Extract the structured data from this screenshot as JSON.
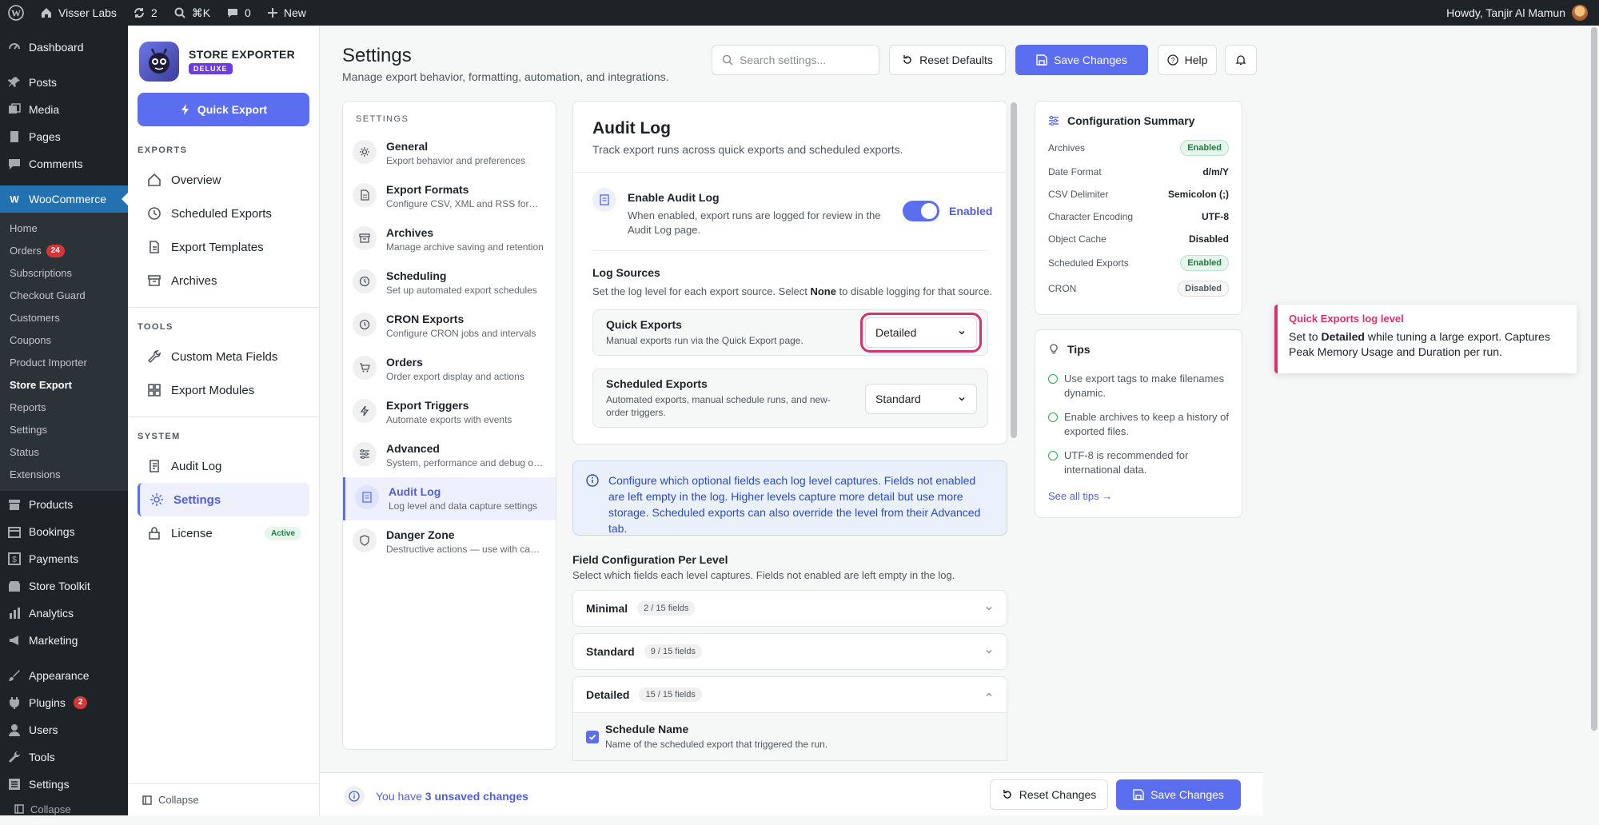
{
  "adminbar": {
    "site": "Visser Labs",
    "updates": "2",
    "shortcut": "⌘K",
    "comments": "0",
    "new": "New",
    "howdy": "Howdy, Tanjir Al Mamun"
  },
  "wpmenu": {
    "top": [
      "Dashboard",
      "Posts",
      "Media",
      "Pages",
      "Comments"
    ],
    "woo": "WooCommerce",
    "sub": [
      {
        "label": "Home"
      },
      {
        "label": "Orders",
        "badge": "24"
      },
      {
        "label": "Subscriptions"
      },
      {
        "label": "Checkout Guard"
      },
      {
        "label": "Customers"
      },
      {
        "label": "Coupons"
      },
      {
        "label": "Product Importer"
      },
      {
        "label": "Store Export"
      },
      {
        "label": "Reports"
      },
      {
        "label": "Settings"
      },
      {
        "label": "Status"
      },
      {
        "label": "Extensions"
      }
    ],
    "bottom": [
      "Products",
      "Bookings",
      "Payments",
      "Store Toolkit",
      "Analytics",
      "Marketing",
      "Appearance",
      "Plugins",
      "Users",
      "Tools",
      "Settings"
    ],
    "plugins_badge": "2",
    "collapse": "Collapse"
  },
  "plugin": {
    "name": "STORE EXPORTER",
    "tier": "DELUXE",
    "quick_export": "Quick Export",
    "sections": {
      "exports": "EXPORTS",
      "tools": "TOOLS",
      "system": "SYSTEM"
    },
    "exports": [
      "Overview",
      "Scheduled Exports",
      "Export Templates",
      "Archives"
    ],
    "tools": [
      "Custom Meta Fields",
      "Export Modules"
    ],
    "system": [
      "Audit Log",
      "Settings",
      "License"
    ],
    "license_status": "Active",
    "collapse": "Collapse"
  },
  "header": {
    "title": "Settings",
    "subtitle": "Manage export behavior, formatting, automation, and integrations.",
    "search_placeholder": "Search settings...",
    "reset": "Reset Defaults",
    "save": "Save Changes",
    "help": "Help"
  },
  "settings_nav": {
    "title": "SETTINGS",
    "items": [
      {
        "title": "General",
        "desc": "Export behavior and preferences"
      },
      {
        "title": "Export Formats",
        "desc": "Configure CSV, XML and RSS formats"
      },
      {
        "title": "Archives",
        "desc": "Manage archive saving and retention"
      },
      {
        "title": "Scheduling",
        "desc": "Set up automated export schedules"
      },
      {
        "title": "CRON Exports",
        "desc": "Configure CRON jobs and intervals"
      },
      {
        "title": "Orders",
        "desc": "Order export display and actions"
      },
      {
        "title": "Export Triggers",
        "desc": "Automate exports with events"
      },
      {
        "title": "Advanced",
        "desc": "System, performance and debug options"
      },
      {
        "title": "Audit Log",
        "desc": "Log level and data capture settings"
      },
      {
        "title": "Danger Zone",
        "desc": "Destructive actions — use with caution"
      }
    ]
  },
  "audit": {
    "title": "Audit Log",
    "subtitle": "Track export runs across quick exports and scheduled exports.",
    "enable_title": "Enable Audit Log",
    "enable_desc": "When enabled, export runs are logged for review in the Audit Log page.",
    "enable_state": "Enabled",
    "sources_title": "Log Sources",
    "sources_desc_pre": "Set the log level for each export source. Select ",
    "sources_desc_bold": "None",
    "sources_desc_post": " to disable logging for that source.",
    "quick_title": "Quick Exports",
    "quick_desc": "Manual exports run via the Quick Export page.",
    "quick_level": "Detailed",
    "sched_title": "Scheduled Exports",
    "sched_desc": "Automated exports, manual schedule runs, and new-order triggers.",
    "sched_level": "Standard",
    "info": "Configure which optional fields each log level captures. Fields not enabled are left empty in the log. Higher levels capture more detail but use more storage. Scheduled exports can also override the level from their Advanced tab.",
    "field_title": "Field Configuration Per Level",
    "field_sub": "Select which fields each level captures. Fields not enabled are left empty in the log.",
    "levels": [
      {
        "name": "Minimal",
        "count": "2 / 15 fields"
      },
      {
        "name": "Standard",
        "count": "9 / 15 fields"
      },
      {
        "name": "Detailed",
        "count": "15 / 15 fields"
      }
    ],
    "field_name": "Schedule Name",
    "field_desc": "Name of the scheduled export that triggered the run."
  },
  "summary": {
    "title": "Configuration Summary",
    "rows": [
      {
        "label": "Archives",
        "value": "Enabled",
        "kind": "pill-g"
      },
      {
        "label": "Date Format",
        "value": "d/m/Y",
        "kind": "text"
      },
      {
        "label": "CSV Delimiter",
        "value": "Semicolon (;)",
        "kind": "text"
      },
      {
        "label": "Character Encoding",
        "value": "UTF-8",
        "kind": "text"
      },
      {
        "label": "Object Cache",
        "value": "Disabled",
        "kind": "text"
      },
      {
        "label": "Scheduled Exports",
        "value": "Enabled",
        "kind": "pill-g"
      },
      {
        "label": "CRON",
        "value": "Disabled",
        "kind": "pill-n"
      }
    ]
  },
  "tips": {
    "title": "Tips",
    "items": [
      "Use export tags to make filenames dynamic.",
      "Enable archives to keep a history of exported files.",
      "UTF-8 is recommended for international data."
    ],
    "see_all": "See all tips →"
  },
  "callout": {
    "title": "Quick Exports log level",
    "pre": "Set to ",
    "bold": "Detailed",
    "post": " while tuning a large export. Captures Peak Memory Usage and Duration per run."
  },
  "bottombar": {
    "pre": "You have ",
    "count": "3 unsaved changes",
    "reset": "Reset Changes",
    "save": "Save Changes"
  },
  "colors": {
    "accent": "#5b6ef0",
    "highlight": "#d6336c",
    "wp_dark": "#1d2327",
    "wp_blue": "#2271b1"
  }
}
